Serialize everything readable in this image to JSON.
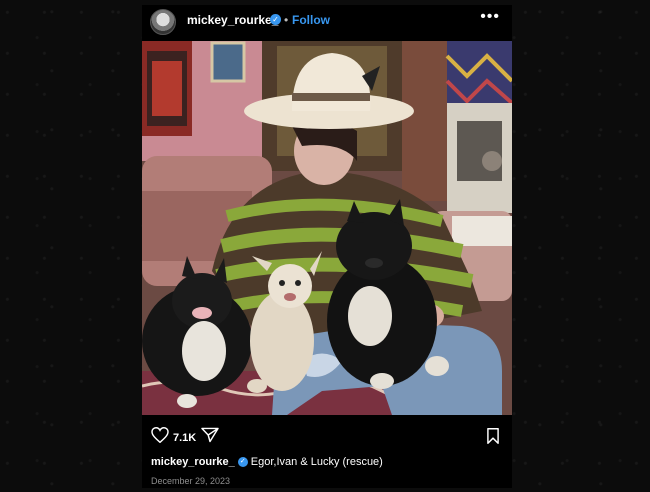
{
  "post": {
    "username": "mickey_rourke_",
    "separator": "•",
    "follow_label": "Follow",
    "more_icon": "more-horizontal-icon",
    "likes": "7.1K",
    "caption_user": "mickey_rourke_",
    "caption_text": "Egor,Ivan & Lucky (rescue)",
    "date": "December 29, 2023"
  },
  "colors": {
    "accent": "#3897f0",
    "background": "#000000",
    "muted": "#8e8e8e"
  }
}
